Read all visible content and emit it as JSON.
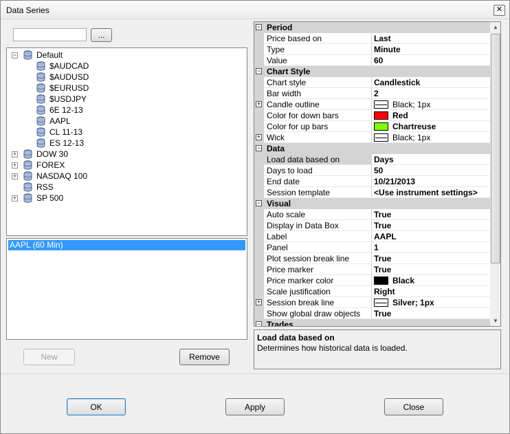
{
  "window": {
    "title": "Data Series",
    "close_glyph": "✕"
  },
  "search": {
    "value": "",
    "browse_label": "..."
  },
  "tree": [
    {
      "label": "Default",
      "expanded": true,
      "level": 0
    },
    {
      "label": "$AUDCAD",
      "level": 1
    },
    {
      "label": "$AUDUSD",
      "level": 1
    },
    {
      "label": "$EURUSD",
      "level": 1
    },
    {
      "label": "$USDJPY",
      "level": 1
    },
    {
      "label": "6E 12-13",
      "level": 1
    },
    {
      "label": "AAPL",
      "level": 1
    },
    {
      "label": "CL 11-13",
      "level": 1
    },
    {
      "label": "ES 12-13",
      "level": 1
    },
    {
      "label": "DOW 30",
      "expanded": false,
      "level": 0
    },
    {
      "label": "FOREX",
      "expanded": false,
      "level": 0
    },
    {
      "label": "NASDAQ 100",
      "expanded": false,
      "level": 0
    },
    {
      "label": "RSS",
      "level": 0
    },
    {
      "label": "SP 500",
      "expanded": false,
      "level": 0
    }
  ],
  "selected_series": "AAPL (60 Min)",
  "buttons": {
    "new": "New",
    "remove": "Remove",
    "ok": "OK",
    "apply": "Apply",
    "close": "Close"
  },
  "properties": [
    {
      "type": "cat",
      "name": "Period"
    },
    {
      "name": "Price based on",
      "value": "Last"
    },
    {
      "name": "Type",
      "value": "Minute"
    },
    {
      "name": "Value",
      "value": "60"
    },
    {
      "type": "cat",
      "name": "Chart Style"
    },
    {
      "name": "Chart style",
      "value": "Candlestick"
    },
    {
      "name": "Bar width",
      "value": "2"
    },
    {
      "name": "Candle outline",
      "expandable": true,
      "swatch": "line",
      "value": "Black; 1px"
    },
    {
      "name": "Color for down bars",
      "swatch": "#ff0000",
      "value": "Red",
      "bold": true
    },
    {
      "name": "Color for up bars",
      "swatch": "#7fff00",
      "value": "Chartreuse",
      "bold": true
    },
    {
      "name": "Wick",
      "expandable": true,
      "swatch": "line",
      "value": "Black; 1px"
    },
    {
      "type": "cat",
      "name": "Data"
    },
    {
      "name": "Load data based on",
      "value": "Days",
      "highlight": true
    },
    {
      "name": "Days to load",
      "value": "50"
    },
    {
      "name": "End date",
      "value": "10/21/2013"
    },
    {
      "name": "Session template",
      "value": "<Use instrument settings>"
    },
    {
      "type": "cat",
      "name": "Visual"
    },
    {
      "name": "Auto scale",
      "value": "True"
    },
    {
      "name": "Display in Data Box",
      "value": "True"
    },
    {
      "name": "Label",
      "value": "AAPL"
    },
    {
      "name": "Panel",
      "value": "1"
    },
    {
      "name": "Plot session break line",
      "value": "True"
    },
    {
      "name": "Price marker",
      "value": "True"
    },
    {
      "name": "Price marker color",
      "swatch": "#000000",
      "value": "Black",
      "bold": true
    },
    {
      "name": "Scale justification",
      "value": "Right"
    },
    {
      "name": "Session break line",
      "expandable": true,
      "swatch": "line",
      "value": "Silver; 1px",
      "bold": true
    },
    {
      "name": "Show global draw objects",
      "value": "True"
    },
    {
      "type": "cat",
      "name": "Trades"
    }
  ],
  "description": {
    "title": "Load data based on",
    "text": "Determines how historical data is loaded."
  },
  "colors": {
    "selection": "#3399ff",
    "category_bg": "#d4d4d4"
  }
}
